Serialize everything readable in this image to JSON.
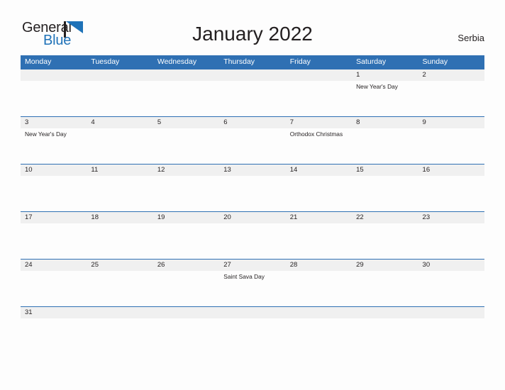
{
  "brand": {
    "name_part1": "General",
    "name_part2": "Blue",
    "flag_icon": "flag-icon"
  },
  "header": {
    "title": "January 2022",
    "region": "Serbia"
  },
  "calendar": {
    "month": "January",
    "year": "2022",
    "country": "Serbia",
    "accent_color": "#2f70b3",
    "date_band_color": "#f0f0f0",
    "day_headers": [
      "Monday",
      "Tuesday",
      "Wednesday",
      "Thursday",
      "Friday",
      "Saturday",
      "Sunday"
    ],
    "weeks": [
      {
        "days": [
          {
            "date": "",
            "event": ""
          },
          {
            "date": "",
            "event": ""
          },
          {
            "date": "",
            "event": ""
          },
          {
            "date": "",
            "event": ""
          },
          {
            "date": "",
            "event": ""
          },
          {
            "date": "1",
            "event": "New Year's Day"
          },
          {
            "date": "2",
            "event": ""
          }
        ]
      },
      {
        "days": [
          {
            "date": "3",
            "event": "New Year's Day"
          },
          {
            "date": "4",
            "event": ""
          },
          {
            "date": "5",
            "event": ""
          },
          {
            "date": "6",
            "event": ""
          },
          {
            "date": "7",
            "event": "Orthodox Christmas"
          },
          {
            "date": "8",
            "event": ""
          },
          {
            "date": "9",
            "event": ""
          }
        ]
      },
      {
        "days": [
          {
            "date": "10",
            "event": ""
          },
          {
            "date": "11",
            "event": ""
          },
          {
            "date": "12",
            "event": ""
          },
          {
            "date": "13",
            "event": ""
          },
          {
            "date": "14",
            "event": ""
          },
          {
            "date": "15",
            "event": ""
          },
          {
            "date": "16",
            "event": ""
          }
        ]
      },
      {
        "days": [
          {
            "date": "17",
            "event": ""
          },
          {
            "date": "18",
            "event": ""
          },
          {
            "date": "19",
            "event": ""
          },
          {
            "date": "20",
            "event": ""
          },
          {
            "date": "21",
            "event": ""
          },
          {
            "date": "22",
            "event": ""
          },
          {
            "date": "23",
            "event": ""
          }
        ]
      },
      {
        "days": [
          {
            "date": "24",
            "event": ""
          },
          {
            "date": "25",
            "event": ""
          },
          {
            "date": "26",
            "event": ""
          },
          {
            "date": "27",
            "event": "Saint Sava Day"
          },
          {
            "date": "28",
            "event": ""
          },
          {
            "date": "29",
            "event": ""
          },
          {
            "date": "30",
            "event": ""
          }
        ]
      },
      {
        "days": [
          {
            "date": "31",
            "event": ""
          },
          {
            "date": "",
            "event": ""
          },
          {
            "date": "",
            "event": ""
          },
          {
            "date": "",
            "event": ""
          },
          {
            "date": "",
            "event": ""
          },
          {
            "date": "",
            "event": ""
          },
          {
            "date": "",
            "event": ""
          }
        ]
      }
    ]
  }
}
